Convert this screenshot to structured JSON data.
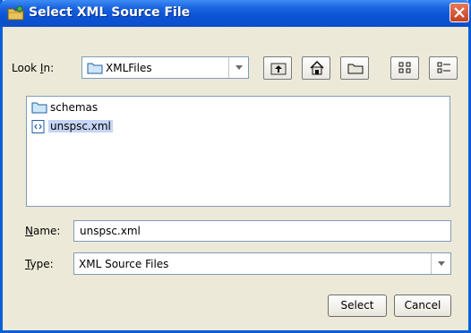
{
  "dialog": {
    "title": "Select XML Source File"
  },
  "look_in": {
    "label_pre": "Look ",
    "label_mnemonic": "I",
    "label_post": "n:",
    "value": "XMLFiles"
  },
  "toolbar": {
    "icons": [
      "up-folder-icon",
      "home-icon",
      "new-folder-icon",
      "list-view-icon",
      "details-view-icon"
    ]
  },
  "files": [
    {
      "name": "schemas",
      "kind": "folder",
      "selected": false
    },
    {
      "name": "unspsc.xml",
      "kind": "xml-file",
      "selected": true
    }
  ],
  "name_field": {
    "label_mnemonic": "N",
    "label_rest": "ame:",
    "value": "unspsc.xml"
  },
  "type_field": {
    "label_mnemonic": "T",
    "label_rest": "ype:",
    "value": "XML Source Files"
  },
  "buttons": {
    "select": "Select",
    "cancel": "Cancel"
  },
  "colors": {
    "titlebar": "#0a54d6",
    "window_bg": "#ece9d8",
    "selection": "#c5d5f5",
    "close_button": "#c4401e"
  }
}
